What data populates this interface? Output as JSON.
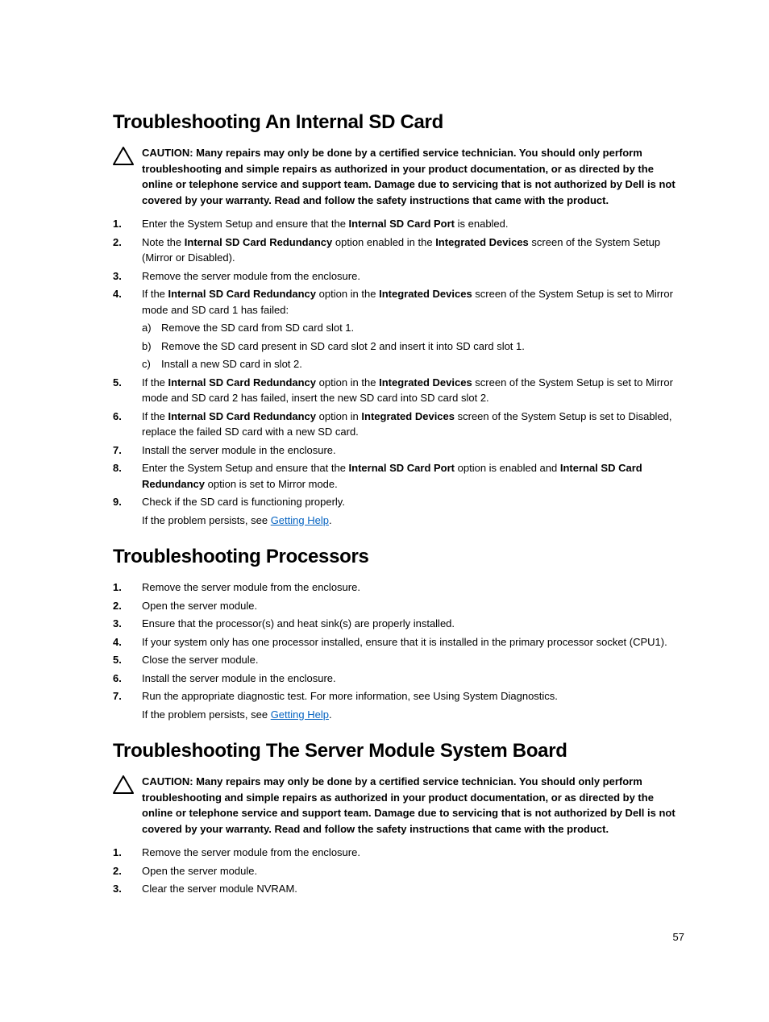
{
  "page_number": "57",
  "link_text": "Getting Help",
  "sd": {
    "heading": "Troubleshooting An Internal SD Card",
    "caution": "CAUTION: Many repairs may only be done by a certified service technician. You should only perform troubleshooting and simple repairs as authorized in your product documentation, or as directed by the online or telephone service and support team. Damage due to servicing that is not authorized by Dell is not covered by your warranty. Read and follow the safety instructions that came with the product.",
    "step1_prefix": "Enter the System Setup and ensure that the ",
    "step1_bold": "Internal SD Card Port",
    "step1_suffix": " is enabled.",
    "step2_prefix": "Note the ",
    "step2_bold1": "Internal SD Card Redundancy",
    "step2_mid": " option enabled in the ",
    "step2_bold2": "Integrated Devices",
    "step2_suffix": " screen of the System Setup (Mirror or Disabled).",
    "step3": "Remove the server module from the enclosure.",
    "step4_prefix": "If the ",
    "step4_bold1": "Internal SD Card Redundancy",
    "step4_mid": " option in the ",
    "step4_bold2": "Integrated Devices",
    "step4_suffix": " screen of the System Setup is set to Mirror mode and SD card 1 has failed:",
    "step4a": "Remove the SD card from SD card slot 1.",
    "step4b": "Remove the SD card present in SD card slot 2 and insert it into SD card slot 1.",
    "step4c": "Install a new SD card in slot 2.",
    "step5_prefix": "If the ",
    "step5_bold1": "Internal SD Card Redundancy",
    "step5_mid": " option in the ",
    "step5_bold2": "Integrated Devices",
    "step5_suffix": " screen of the System Setup is set to Mirror mode and SD card 2 has failed, insert the new SD card into SD card slot 2.",
    "step6_prefix": "If the ",
    "step6_bold1": "Internal SD Card Redundancy",
    "step6_mid": " option in ",
    "step6_bold2": "Integrated Devices",
    "step6_suffix": " screen of the System Setup is set to Disabled, replace the failed SD card with a new SD card.",
    "step7": "Install the server module in the enclosure.",
    "step8_prefix": "Enter the System Setup and ensure that the ",
    "step8_bold1": "Internal SD Card Port",
    "step8_mid": " option is enabled and ",
    "step8_bold2": "Internal SD Card Redundancy",
    "step8_suffix": " option is set to Mirror mode.",
    "step9": "Check if the SD card is functioning properly.",
    "step9_persist": "If the problem persists, see "
  },
  "proc": {
    "heading": "Troubleshooting Processors",
    "step1": "Remove the server module from the enclosure.",
    "step2": "Open the server module.",
    "step3": "Ensure that the processor(s) and heat sink(s) are properly installed.",
    "step4": "If your system only has one processor installed, ensure that it is installed in the primary processor socket (CPU1).",
    "step5": "Close the server module.",
    "step6": "Install the server module in the enclosure.",
    "step7": "Run the appropriate diagnostic test. For more information, see Using System Diagnostics.",
    "step7_persist": "If the problem persists, see "
  },
  "board": {
    "heading": "Troubleshooting The Server Module System Board",
    "caution": "CAUTION: Many repairs may only be done by a certified service technician. You should only perform troubleshooting and simple repairs as authorized in your product documentation, or as directed by the online or telephone service and support team. Damage due to servicing that is not authorized by Dell is not covered by your warranty. Read and follow the safety instructions that came with the product.",
    "step1": "Remove the server module from the enclosure.",
    "step2": "Open the server module.",
    "step3": "Clear the server module NVRAM."
  }
}
